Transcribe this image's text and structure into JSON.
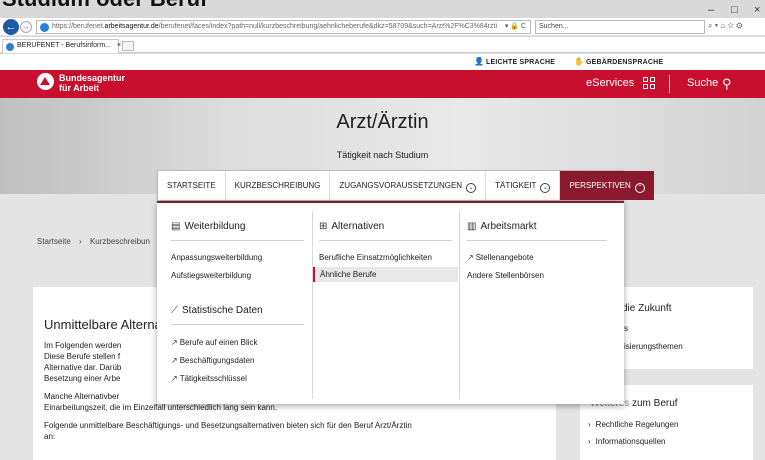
{
  "page_title_cut": "Studium oder Beruf",
  "browser": {
    "url_prefix": "https://berufenet.",
    "url_domain": "arbeitsagentur.de",
    "url_rest": "/berufenet/faces/index?path=null/kurzbeschreibung/aehnlicheberufe&dkz=58709&such=Arzt%2F%C3%84rzti",
    "url_tools": "▾ 🔒 C",
    "search_placeholder": "Suchen...",
    "tab_label": "BERUFENET - Berufsinform...",
    "tab_close": "×",
    "win_min": "–",
    "win_max": "□",
    "win_close": "×",
    "back_glyph": "←",
    "fwd_glyph": "→",
    "search_tools": "⌕ ▾   ⌂ ☆ ⚙"
  },
  "topbar": {
    "leichte_sprache": "LEICHTE SPRACHE",
    "gebaerdensprache": "GEBÄRDENSPRACHE"
  },
  "header": {
    "brand_line1": "Bundesagentur",
    "brand_line2": "für Arbeit",
    "eservices": "eServices",
    "suche": "Suche",
    "accent": "#c8102e"
  },
  "hero": {
    "title": "Arzt/Ärztin",
    "subtitle": "Tätigkeit nach Studium"
  },
  "nav": {
    "tabs": [
      {
        "label": "STARTSEITE"
      },
      {
        "label": "KURZBESCHREIBUNG"
      },
      {
        "label": "ZUGANGSVORAUSSETZUNGEN"
      },
      {
        "label": "TÄTIGKEIT"
      },
      {
        "label": "PERSPEKTIVEN"
      }
    ],
    "active_color": "#8b1a2f"
  },
  "breadcrumb": {
    "home": "Startseite",
    "sep": "›",
    "current": "Kurzbeschreibun"
  },
  "mega": {
    "weiterbildung": {
      "title": "Weiterbildung",
      "items": [
        "Anpassungsweiterbildung",
        "Aufstiegsweiterbildung"
      ]
    },
    "alternativen": {
      "title": "Alternativen",
      "items": [
        "Berufliche Einsatzmöglichkeiten",
        "Ähnliche Berufe"
      ]
    },
    "arbeitsmarkt": {
      "title": "Arbeitsmarkt",
      "items": [
        "Stellenangebote",
        "Andere Stellenbörsen"
      ]
    },
    "statistik": {
      "title": "Statistische Daten",
      "items": [
        "Berufe auf einen Blick",
        "Beschäftigungsdaten",
        "Tätigkeitsschlüssel"
      ]
    }
  },
  "main": {
    "heading": "Unmittelbare Alternativen",
    "p1_l1": "Im Folgenden werden",
    "p1_l2": "Diese Berufe stellen f",
    "p1_l3": "Alternative dar. Darüb",
    "p1_l4": "Besetzung einer Arbe",
    "p2_l1": "Manche Alternativber",
    "p2_l2": "Einarbeitungszeit, die im Einzelfall unterschiedlich lang sein kann.",
    "p3_l1": "Folgende unmittelbare Beschäftigungs- und Besetzungsalternativen bieten sich für den Beruf Arzt/Ärztin",
    "p3_l2": "an:"
  },
  "right": {
    "box1_head": "die Zukunft",
    "box1_line1": "s",
    "box1_line2": "isierungsthemen",
    "box2_head_pre": "Weiteres",
    "box2_head": "zum Beruf",
    "links": [
      "Rechtliche Regelungen",
      "Informationsquellen"
    ]
  }
}
